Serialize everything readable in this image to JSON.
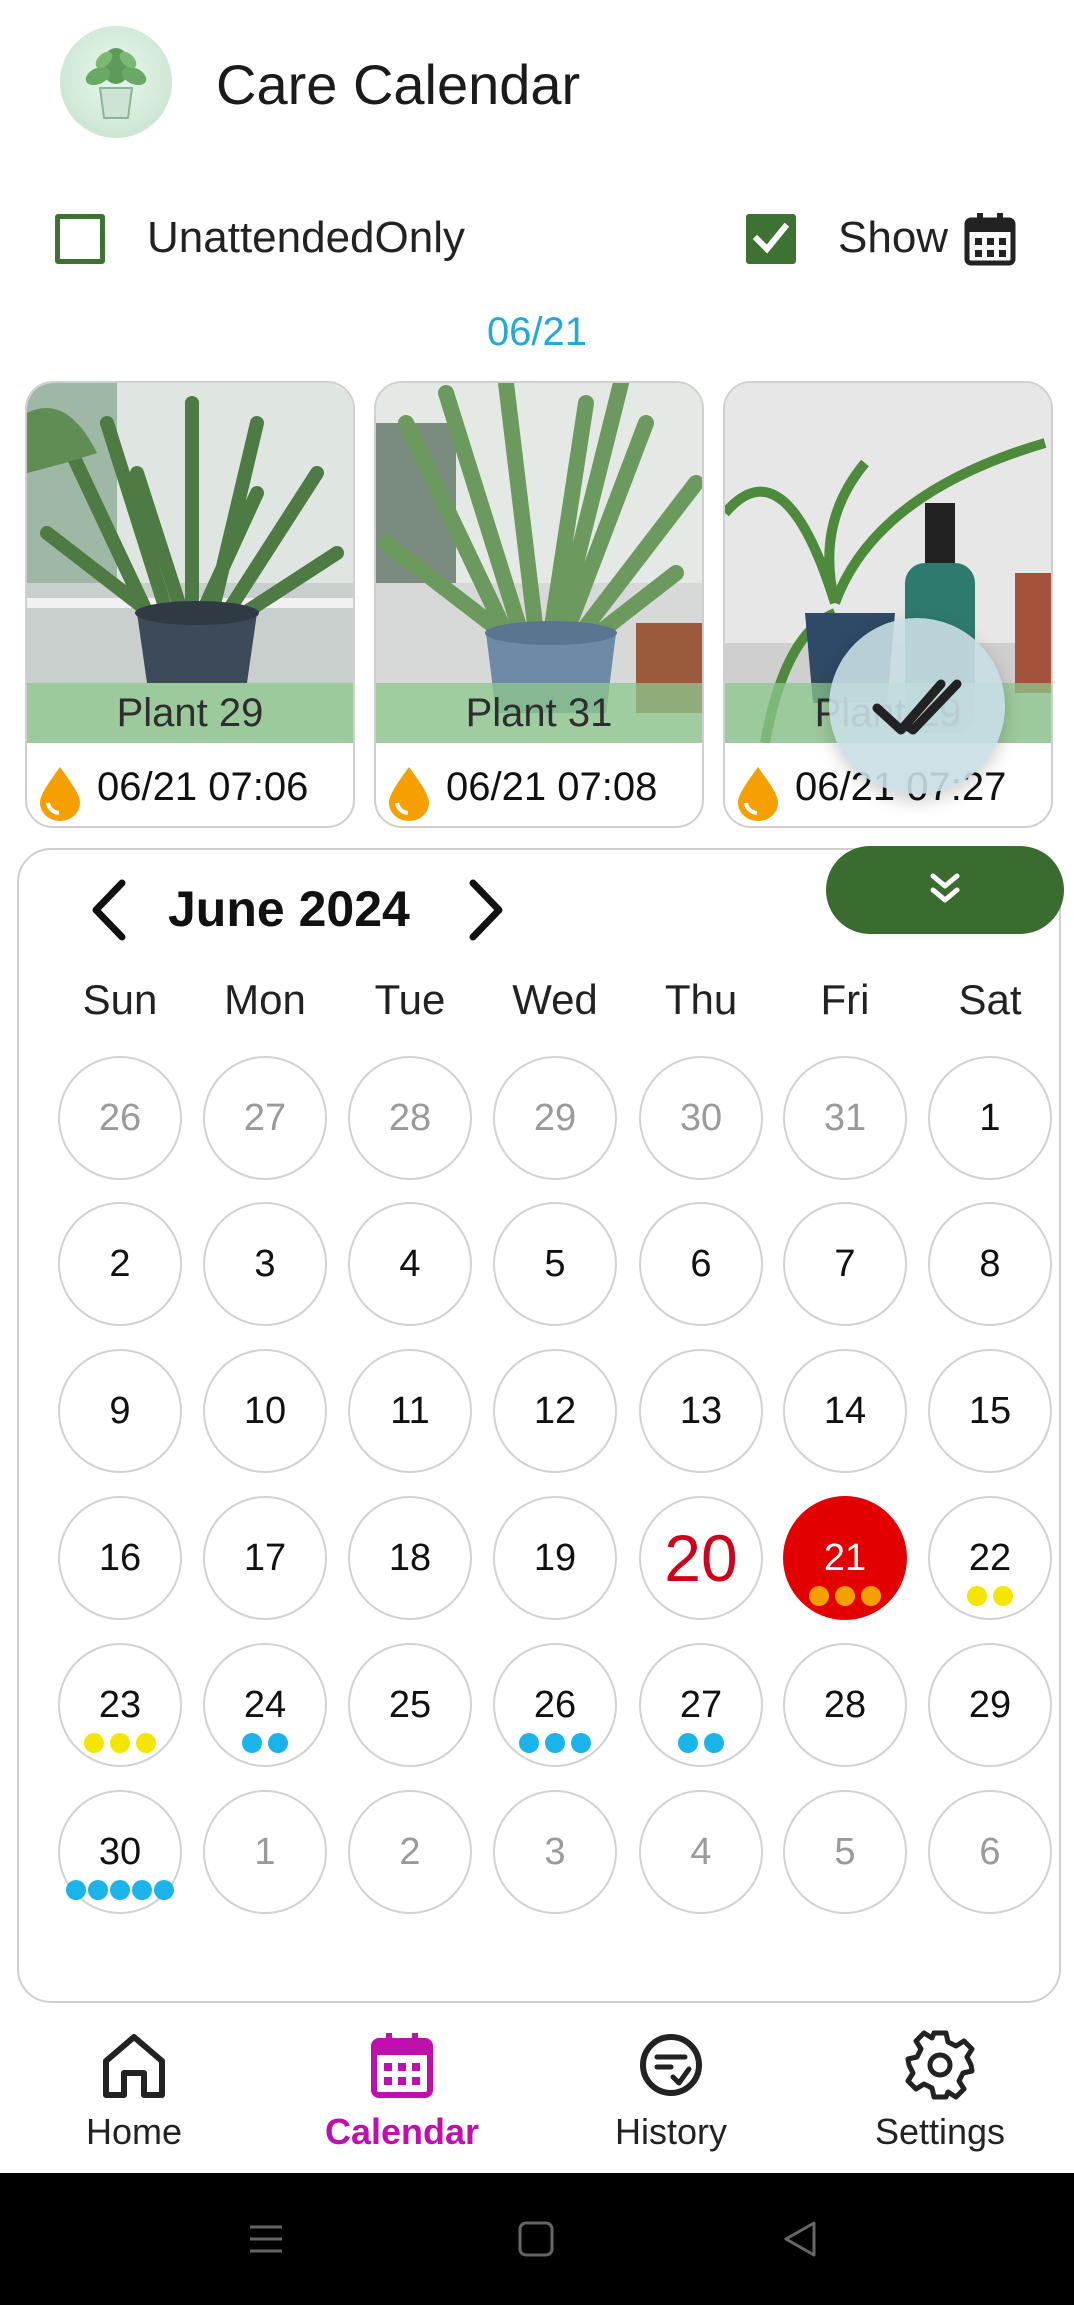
{
  "app": {
    "title": "Care Calendar"
  },
  "filters": {
    "unattended_label": "UnattendedOnly",
    "unattended_checked": false,
    "show_label": "Show",
    "show_checked": true
  },
  "selected_date": "06/21",
  "cards": [
    {
      "name": "Plant 29",
      "time": "06/21 07:06"
    },
    {
      "name": "Plant 31",
      "time": "06/21 07:08"
    },
    {
      "name": "Plant 29",
      "time": "06/21 07:27"
    }
  ],
  "calendar": {
    "month": "June 2024",
    "weekdays": [
      "Sun",
      "Mon",
      "Tue",
      "Wed",
      "Thu",
      "Fri",
      "Sat"
    ],
    "weeks": [
      [
        "26",
        "27",
        "28",
        "29",
        "30",
        "31",
        "1"
      ],
      [
        "2",
        "3",
        "4",
        "5",
        "6",
        "7",
        "8"
      ],
      [
        "9",
        "10",
        "11",
        "12",
        "13",
        "14",
        "15"
      ],
      [
        "16",
        "17",
        "18",
        "19",
        "20",
        "21",
        "22"
      ],
      [
        "23",
        "24",
        "25",
        "26",
        "27",
        "28",
        "29"
      ],
      [
        "30",
        "1",
        "2",
        "3",
        "4",
        "5",
        "6"
      ]
    ]
  },
  "nav": {
    "home": "Home",
    "calendar": "Calendar",
    "history": "History",
    "settings": "Settings"
  },
  "colors": {
    "accent_green": "#3a6b2f",
    "selected_red": "#e30000",
    "today_red": "#d0021b",
    "date_blue": "#1fa9dd",
    "nav_active": "#c10fae",
    "dot_orange": "#f5a000",
    "dot_yellow": "#f4e600",
    "dot_blue": "#1ab4ea"
  },
  "icons": {
    "water": "water-drop-icon",
    "calendar": "calendar-icon",
    "fab": "double-check-icon",
    "collapse": "chevrons-down-icon"
  }
}
